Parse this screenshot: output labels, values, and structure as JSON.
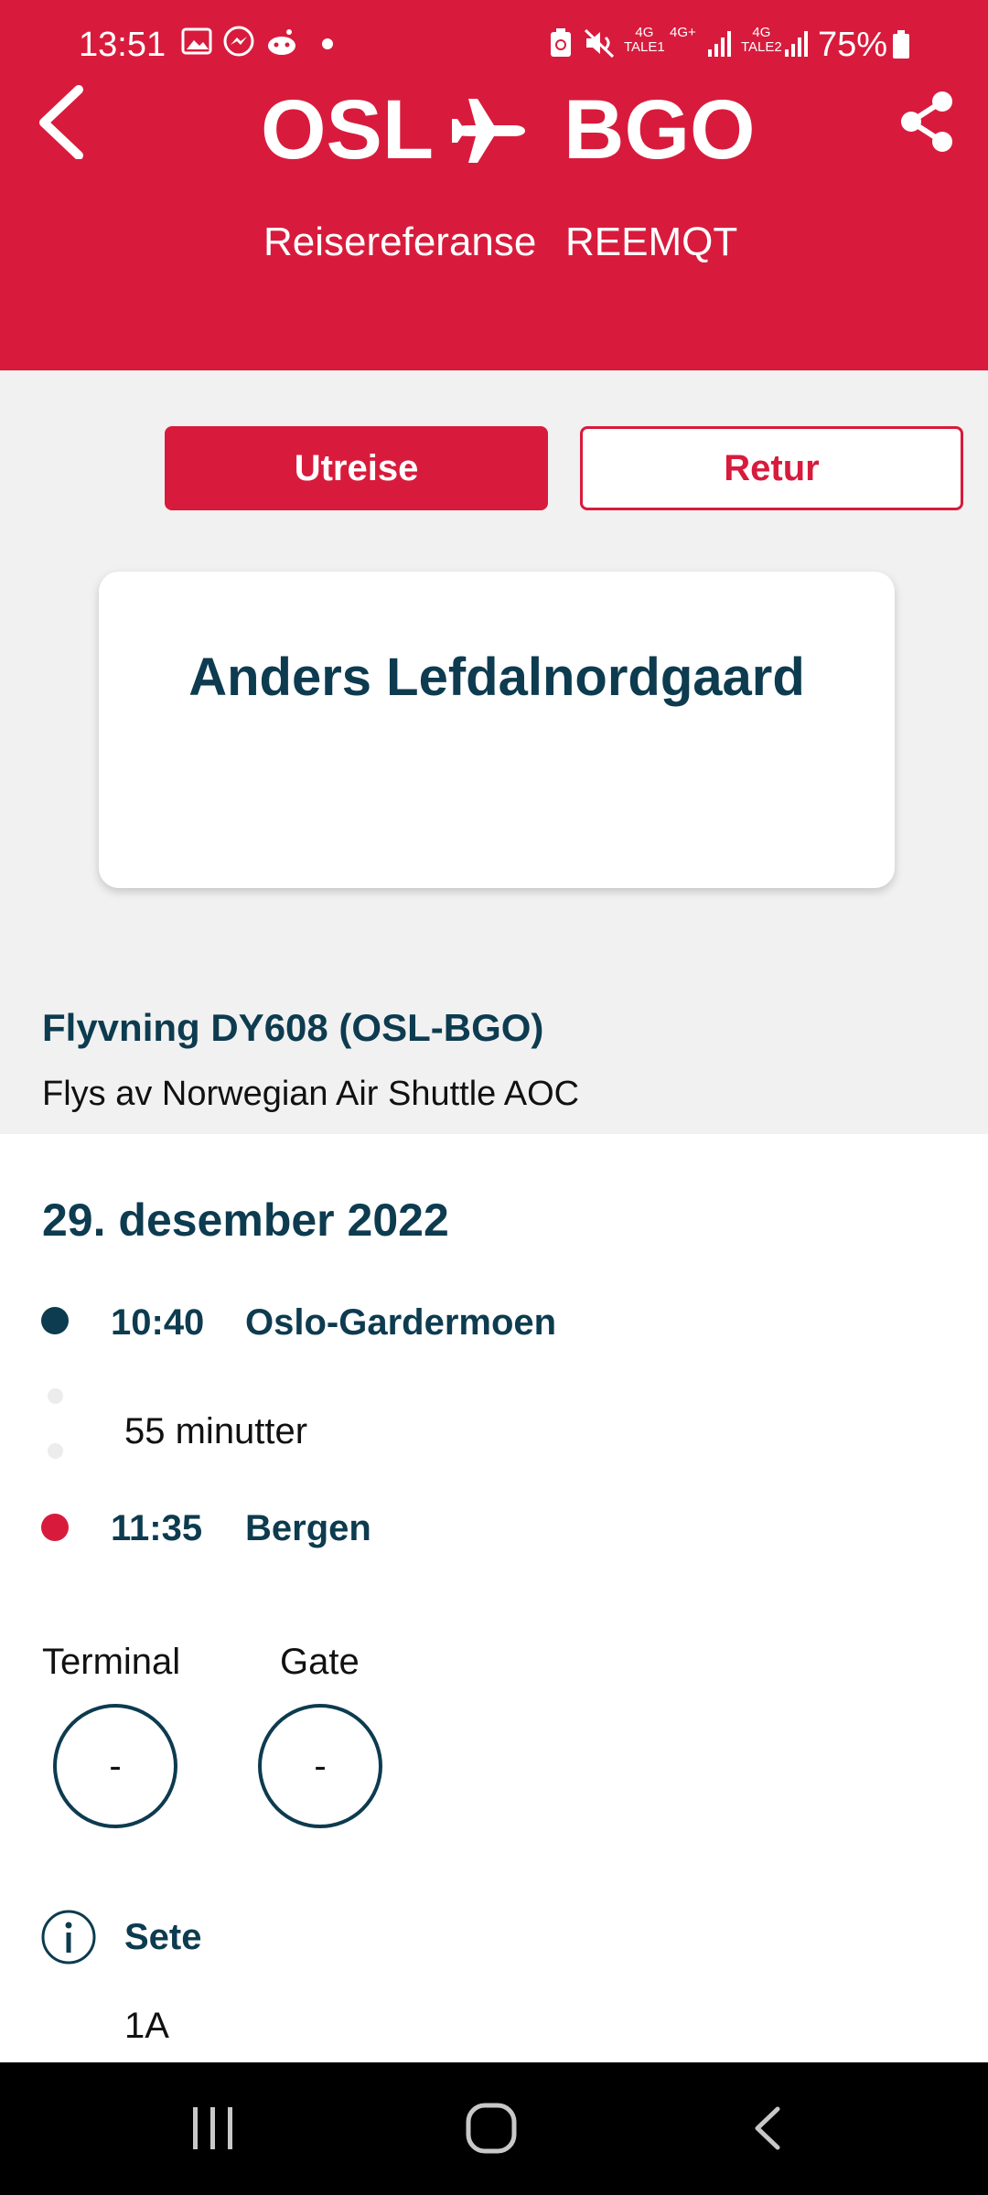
{
  "status_bar": {
    "time": "13:51",
    "network_label_1": "4G",
    "network_sub_1": "TALE1",
    "network_label_2": "4G+",
    "network_label_3": "4G",
    "network_sub_3": "TALE2",
    "battery": "75%"
  },
  "header": {
    "origin": "OSL",
    "destination": "BGO",
    "reference_label": "Reisereferanse",
    "reference_value": "REEMQT",
    "color": "#d81b3c"
  },
  "tabs": {
    "outbound": "Utreise",
    "return": "Retur",
    "active": "outbound"
  },
  "passenger": {
    "name": "Anders Lefdalnordgaard"
  },
  "flight": {
    "title": "Flyvning DY608 (OSL-BGO)",
    "operator": "Flys av Norwegian Air Shuttle AOC",
    "date": "29. desember 2022",
    "departure": {
      "time": "10:40",
      "airport": "Oslo-Gardermoen"
    },
    "duration": "55 minutter",
    "arrival": {
      "time": "11:35",
      "airport": "Bergen"
    },
    "terminal_label": "Terminal",
    "terminal_value": "-",
    "gate_label": "Gate",
    "gate_value": "-",
    "seat_label": "Sete",
    "seat_value": "1A"
  },
  "icons": [
    "back-arrow-icon",
    "airplane-icon",
    "share-icon",
    "info-icon",
    "recent-apps-icon",
    "home-icon",
    "nav-back-icon"
  ]
}
